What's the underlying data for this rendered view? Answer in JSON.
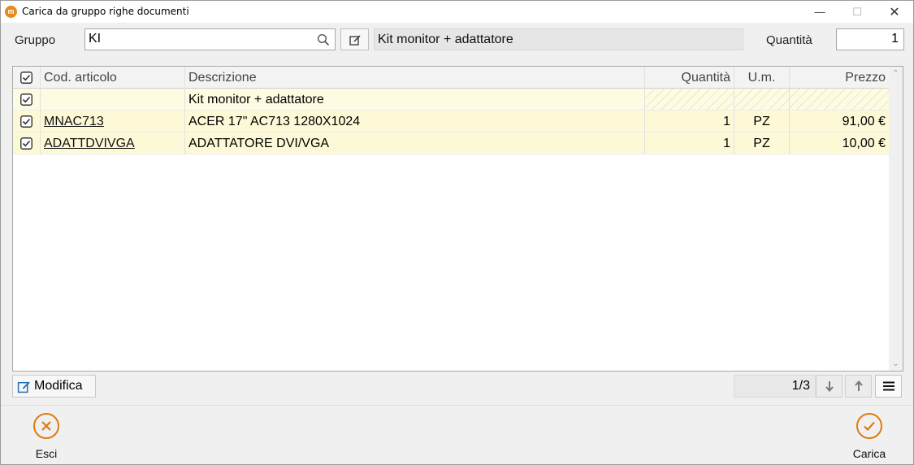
{
  "window": {
    "title": "Carica da gruppo righe documenti",
    "controls": {
      "minimize": "—",
      "maximize": "☐",
      "close": "✕"
    },
    "accent_color": "#e07a10"
  },
  "form": {
    "gruppo_label": "Gruppo",
    "gruppo_value": "KI",
    "gruppo_description": "Kit monitor + adattatore",
    "quantita_label": "Quantità",
    "quantita_value": "1"
  },
  "grid": {
    "headers": {
      "cod": "Cod. articolo",
      "desc": "Descrizione",
      "qty": "Quantità",
      "um": "U.m.",
      "price": "Prezzo"
    },
    "group_row": {
      "desc": "Kit monitor + adattatore",
      "checked": true
    },
    "rows": [
      {
        "cod": "MNAC713",
        "desc": "ACER 17\" AC713 1280X1024",
        "qty": "1",
        "um": "PZ",
        "price": "91,00 €",
        "checked": true
      },
      {
        "cod": "ADATTDVIVGA",
        "desc": "ADATTATORE DVI/VGA",
        "qty": "1",
        "um": "PZ",
        "price": "10,00 €",
        "checked": true
      }
    ]
  },
  "toolbar": {
    "modifica_label": "Modifica",
    "pager": "1/3"
  },
  "footer": {
    "esci_label": "Esci",
    "carica_label": "Carica"
  }
}
